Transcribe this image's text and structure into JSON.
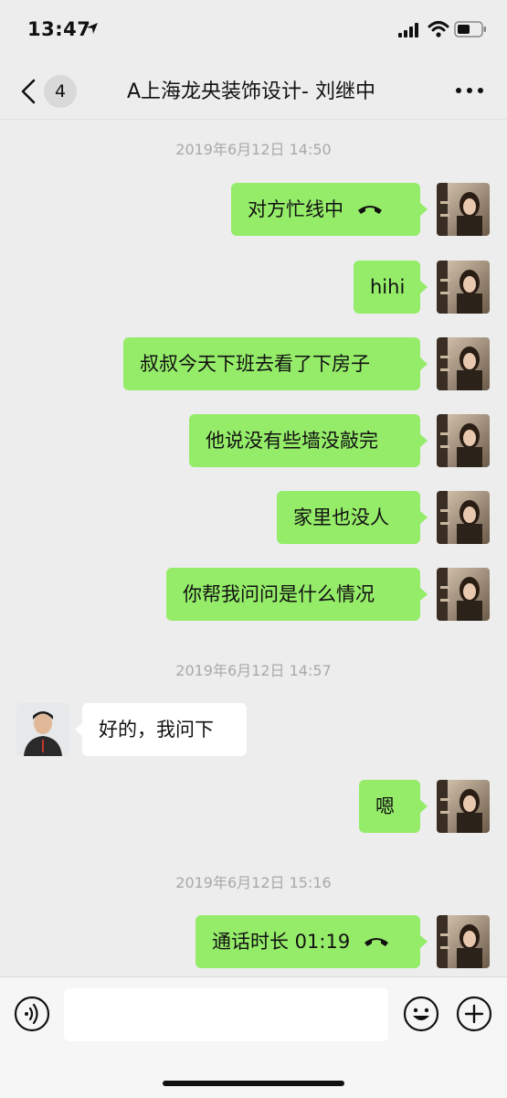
{
  "status_bar": {
    "time": "13:47"
  },
  "nav": {
    "back_label": "<",
    "unread_count": "4",
    "title": "A上海龙央装饰设计- 刘继中",
    "more_icon": "more-dots-icon"
  },
  "timestamps": [
    "2019年6月12日 14:50",
    "2019年6月12日 14:57",
    "2019年6月12日 15:16"
  ],
  "messages": [
    {
      "sender": "me",
      "text": "对方忙线中",
      "icon": "hangup-phone-icon"
    },
    {
      "sender": "me",
      "text": "hihi"
    },
    {
      "sender": "me",
      "text": "叔叔今天下班去看了下房子"
    },
    {
      "sender": "me",
      "text": "他说没有些墙没敲完"
    },
    {
      "sender": "me",
      "text": "家里也没人"
    },
    {
      "sender": "me",
      "text": "你帮我问问是什么情况"
    },
    {
      "sender": "other",
      "text": "好的，我问下"
    },
    {
      "sender": "me",
      "text": "嗯"
    },
    {
      "sender": "me",
      "text": "通话时长 01:19",
      "icon": "hangup-phone-icon"
    }
  ],
  "input_bar": {
    "text_value": "",
    "voice_icon": "voice-icon",
    "emoji_icon": "emoji-icon",
    "plus_icon": "plus-icon"
  },
  "colors": {
    "background": "#ededed",
    "my_bubble": "#95ec69",
    "other_bubble": "#ffffff",
    "timestamp": "#a9a9a9"
  }
}
